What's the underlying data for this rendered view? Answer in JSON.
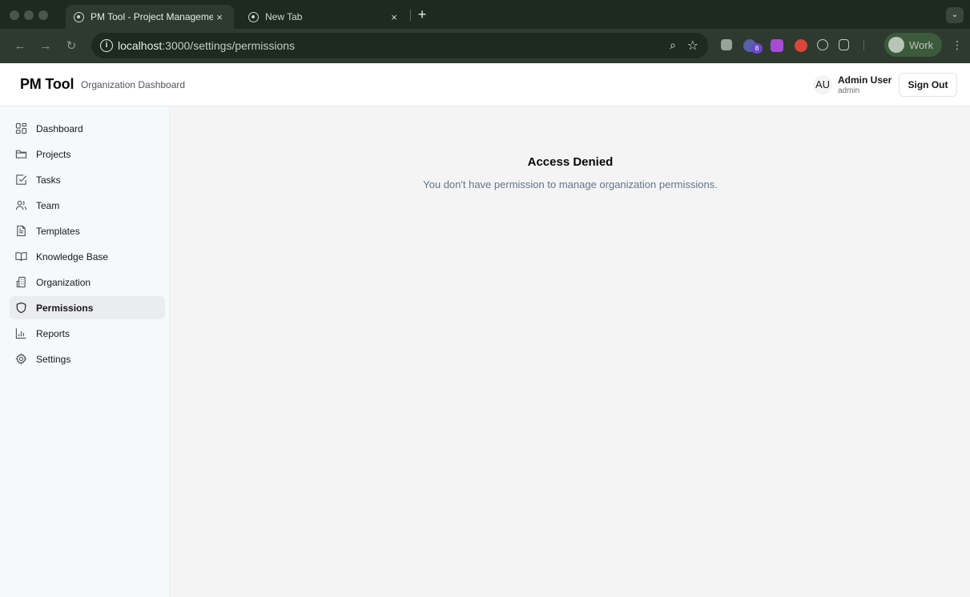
{
  "browser": {
    "tabs": [
      {
        "title": "PM Tool - Project Manageme",
        "close": "×"
      },
      {
        "title": "New Tab",
        "close": "×"
      }
    ],
    "new_tab": "+",
    "url_host": "localhost",
    "url_path": ":3000/settings/permissions",
    "extension_badge": "8",
    "profile_label": "Work"
  },
  "app": {
    "brand": "PM Tool",
    "subtitle": "Organization Dashboard",
    "user": {
      "initials": "AU",
      "name": "Admin User",
      "role": "admin"
    },
    "sign_out": "Sign Out"
  },
  "sidebar": {
    "items": [
      {
        "label": "Dashboard",
        "icon": "layout-grid-icon"
      },
      {
        "label": "Projects",
        "icon": "folder-icon"
      },
      {
        "label": "Tasks",
        "icon": "check-square-icon"
      },
      {
        "label": "Team",
        "icon": "users-icon"
      },
      {
        "label": "Templates",
        "icon": "file-text-icon"
      },
      {
        "label": "Knowledge Base",
        "icon": "book-open-icon"
      },
      {
        "label": "Organization",
        "icon": "building-icon"
      },
      {
        "label": "Permissions",
        "icon": "shield-icon",
        "active": true
      },
      {
        "label": "Reports",
        "icon": "bar-chart-icon"
      },
      {
        "label": "Settings",
        "icon": "settings-icon"
      }
    ]
  },
  "main": {
    "title": "Access Denied",
    "message": "You don't have permission to manage organization permissions."
  },
  "colors": {
    "browser_frame": "#1e2a1e",
    "browser_toolbar": "#2d3a2d",
    "sidebar_bg": "#f5f9f9",
    "active_item_bg": "#ebecef",
    "muted_text": "#64748b"
  }
}
